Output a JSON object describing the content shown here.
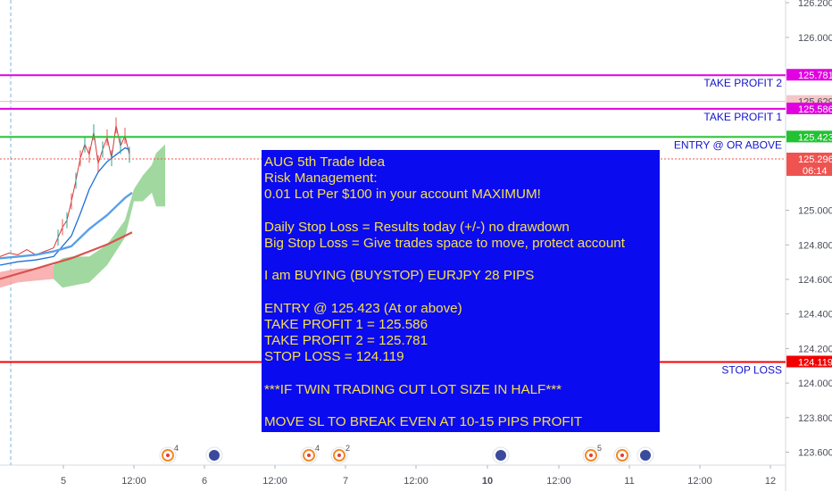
{
  "colors": {
    "take_profit": "#e100e1",
    "entry": "#22c232",
    "stop_loss": "#f20000",
    "price_label": "#ef5350",
    "note_bg": "#0b0bef",
    "note_text": "#f5e04a",
    "label_text": "#1414c8"
  },
  "chart_data": {
    "type": "line",
    "title": "",
    "instrument": "EURJPY",
    "y_axis_ticks": [
      "126.200",
      "126.000",
      "125.000",
      "124.800",
      "124.600",
      "124.400",
      "124.200",
      "124.000",
      "123.800",
      "123.600"
    ],
    "ylim": [
      123.55,
      126.22
    ],
    "x_axis_ticks": [
      {
        "label": "5",
        "bold": false
      },
      {
        "label": "12:00",
        "bold": false
      },
      {
        "label": "6",
        "bold": false
      },
      {
        "label": "12:00",
        "bold": false
      },
      {
        "label": "7",
        "bold": false
      },
      {
        "label": "12:00",
        "bold": false
      },
      {
        "label": "10",
        "bold": true
      },
      {
        "label": "12:00",
        "bold": false
      },
      {
        "label": "11",
        "bold": false
      },
      {
        "label": "12:00",
        "bold": false
      },
      {
        "label": "12",
        "bold": false
      }
    ],
    "levels": [
      {
        "name": "take_profit_2",
        "price": 125.781,
        "price_label": "125.781",
        "label": "TAKE PROFIT 2",
        "color": "#e100e1"
      },
      {
        "name": "reference",
        "price": 125.629,
        "price_label": "125.629",
        "label": "",
        "color": "#f2b8b8"
      },
      {
        "name": "take_profit_1",
        "price": 125.586,
        "price_label": "125.586",
        "label": "TAKE PROFIT 1",
        "color": "#e100e1"
      },
      {
        "name": "entry",
        "price": 125.423,
        "price_label": "125.423",
        "label": "ENTRY @ OR ABOVE",
        "color": "#22c232"
      },
      {
        "name": "last_price",
        "price": 125.296,
        "price_label": "125.296",
        "countdown": "06:14",
        "label": "",
        "color": "#ef5350"
      },
      {
        "name": "stop_loss",
        "price": 124.119,
        "price_label": "124.119",
        "label": "STOP LOSS",
        "color": "#f20000"
      }
    ],
    "series": [
      {
        "name": "",
        "kind": "price",
        "x": [
          0,
          10,
          20,
          30,
          40,
          50,
          60,
          65,
          70,
          75,
          80,
          85,
          90,
          95,
          100,
          105,
          110,
          115,
          120,
          125,
          130,
          135,
          140,
          145
        ],
        "y": [
          124.73,
          124.75,
          124.74,
          124.77,
          124.74,
          124.76,
          124.78,
          124.84,
          124.9,
          124.94,
          125.05,
          125.17,
          125.3,
          125.38,
          125.32,
          125.45,
          125.27,
          125.35,
          125.42,
          125.3,
          125.49,
          125.37,
          125.43,
          125.32
        ]
      },
      {
        "name": "",
        "kind": "ma_fast",
        "x": [
          0,
          20,
          40,
          60,
          80,
          90,
          100,
          110,
          120,
          130,
          140,
          145
        ],
        "y": [
          124.68,
          124.7,
          124.71,
          124.73,
          124.85,
          124.98,
          125.12,
          125.22,
          125.28,
          125.32,
          125.36,
          125.35
        ]
      },
      {
        "name": "",
        "kind": "ma_mid",
        "x": [
          0,
          20,
          40,
          60,
          80,
          90,
          100,
          110,
          120,
          130,
          140,
          148
        ],
        "y": [
          124.72,
          124.73,
          124.74,
          124.76,
          124.79,
          124.84,
          124.89,
          124.93,
          124.97,
          125.02,
          125.07,
          125.1
        ]
      },
      {
        "name": "",
        "kind": "ma_slow",
        "x": [
          0,
          20,
          40,
          60,
          80,
          100,
          120,
          148
        ],
        "y": [
          124.6,
          124.63,
          124.66,
          124.69,
          124.72,
          124.76,
          124.8,
          124.87
        ]
      }
    ],
    "cloud": {
      "x": [
        0,
        20,
        40,
        60,
        70,
        80,
        100,
        120,
        140,
        150,
        160,
        170,
        175,
        185
      ],
      "upper": [
        124.64,
        124.66,
        124.66,
        124.68,
        124.72,
        124.73,
        124.73,
        124.8,
        124.94,
        125.12,
        125.2,
        125.26,
        125.33,
        125.38
      ],
      "lower": [
        124.55,
        124.58,
        124.59,
        124.6,
        124.55,
        124.56,
        124.58,
        124.68,
        124.84,
        125.05,
        125.05,
        125.1,
        125.02,
        125.02
      ],
      "bear_until": 60
    },
    "event_markers": [
      {
        "kind": "news",
        "count": "4"
      },
      {
        "kind": "flag",
        "count": ""
      },
      {
        "kind": "news",
        "count": "4"
      },
      {
        "kind": "news",
        "count": "2"
      },
      {
        "kind": "flag",
        "count": ""
      },
      {
        "kind": "news",
        "count": "5"
      },
      {
        "kind": "news",
        "count": ""
      },
      {
        "kind": "flag",
        "count": ""
      }
    ],
    "grid": false,
    "legend": "none"
  },
  "note": {
    "lines": [
      "AUG 5th Trade Idea",
      "Risk Management:",
      "0.01 Lot Per $100 in your account MAXIMUM!",
      "",
      "Daily Stop Loss = Results today (+/-) no drawdown",
      "Big Stop Loss = Give trades space to move, protect account",
      "",
      "I am BUYING (BUYSTOP) EURJPY 28 PIPS",
      "",
      "ENTRY @ 125.423 (At or above)",
      "TAKE PROFIT 1 = 125.586",
      "TAKE PROFIT 2 = 125.781",
      "STOP LOSS = 124.119",
      "",
      "***IF TWIN TRADING CUT LOT SIZE IN HALF***",
      "",
      "MOVE SL TO BREAK EVEN AT 10-15 PIPS PROFIT"
    ]
  }
}
